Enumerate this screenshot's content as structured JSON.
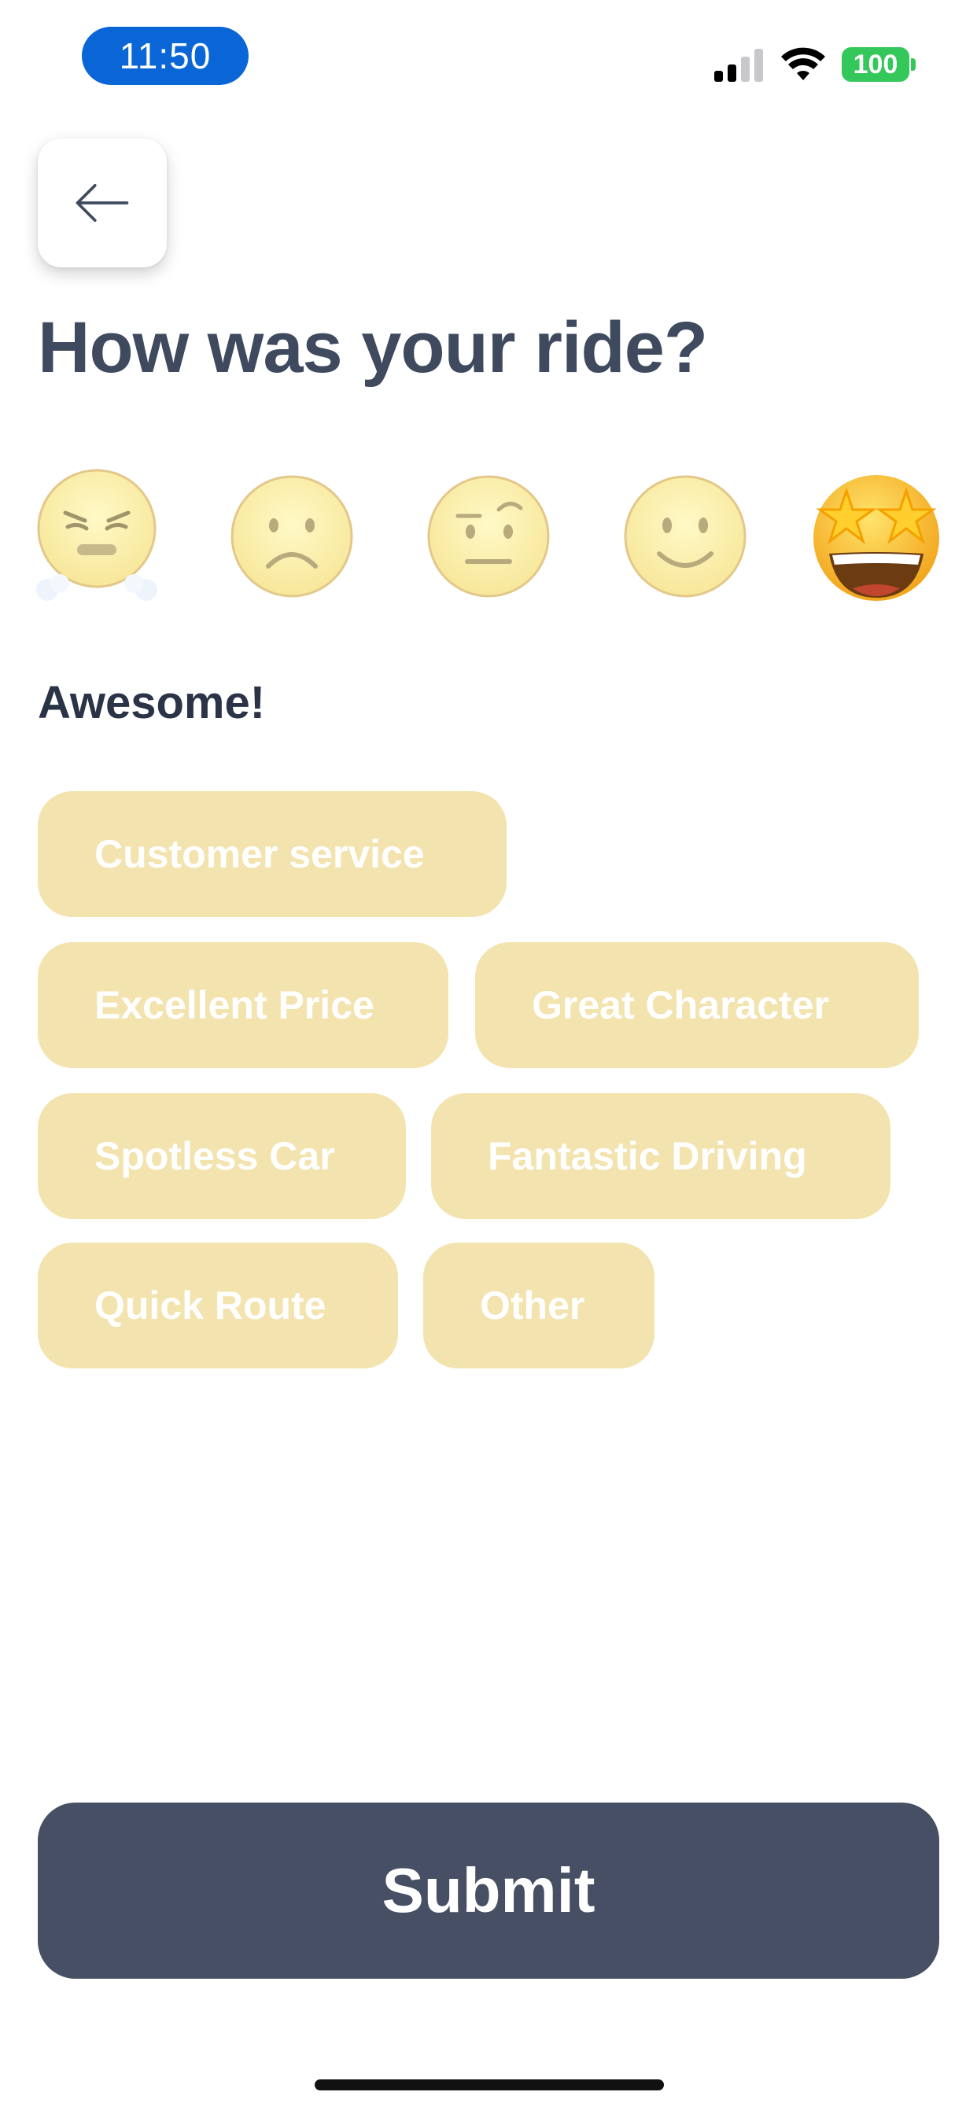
{
  "status_bar": {
    "time": "11:50",
    "battery": "100",
    "signal_icon": "signal-icon",
    "wifi_icon": "wifi-icon"
  },
  "header": {
    "back_icon": "arrow-left-icon",
    "title": "How was your ride?"
  },
  "ratings": [
    {
      "name": "steaming-angry-face",
      "icon": "angry-face-icon"
    },
    {
      "name": "frowning-face",
      "icon": "sad-face-icon"
    },
    {
      "name": "skeptical-face",
      "icon": "raised-eyebrow-face-icon"
    },
    {
      "name": "slightly-smiling-face",
      "icon": "smiling-face-icon"
    },
    {
      "name": "star-struck-face",
      "icon": "star-eyes-face-icon",
      "selected": true
    }
  ],
  "selected_rating_label": "Awesome!",
  "tags": [
    "Customer service",
    "Excellent Price",
    "Great Character",
    "Spotless Car",
    "Fantastic Driving",
    "Quick Route",
    "Other"
  ],
  "submit_label": "Submit",
  "colors": {
    "title": "#3f4a5e",
    "tag_bg": "#f3e3ae",
    "submit_bg": "#464f63",
    "time_pill": "#0a66d6",
    "battery": "#34c759"
  }
}
